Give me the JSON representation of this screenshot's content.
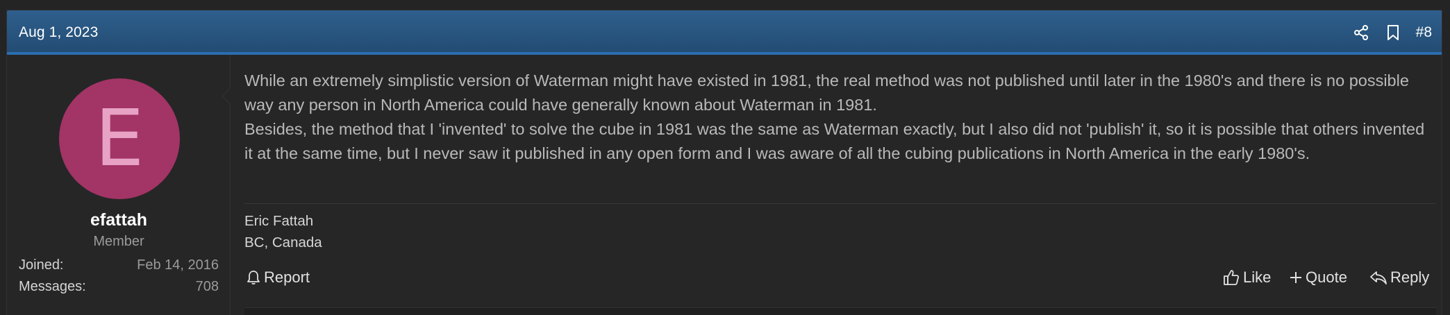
{
  "post": {
    "date": "Aug 1, 2023",
    "number": "#8",
    "header_icons": [
      "share-icon",
      "bookmark-icon"
    ]
  },
  "user": {
    "avatar_letter": "E",
    "avatar_color": "#a33466",
    "name": "efattah",
    "title": "Member",
    "stats": {
      "joined_label": "Joined:",
      "joined_value": "Feb 14, 2016",
      "messages_label": "Messages:",
      "messages_value": "708"
    }
  },
  "message": {
    "paragraphs": [
      "While an extremely simplistic version of Waterman might have existed in 1981, the real method was not published until later in the 1980's and there is no possible way any person in North America could have generally known about Waterman in 1981.",
      "Besides, the method that I 'invented' to solve the cube in 1981 was the same as Waterman exactly, but I also did not 'publish' it, so it is possible that others invented it at the same time, but I never saw it published in any open form and I was aware of all the cubing publications in North America in the early 1980's."
    ]
  },
  "signature": {
    "line1": "Eric Fattah",
    "line2": "BC, Canada"
  },
  "actions": {
    "report": "Report",
    "like": "Like",
    "quote": "Quote",
    "reply": "Reply"
  },
  "colors": {
    "header_bg": "#2f5f8d",
    "header_accent": "#2b6db0",
    "page_bg": "#242424"
  }
}
